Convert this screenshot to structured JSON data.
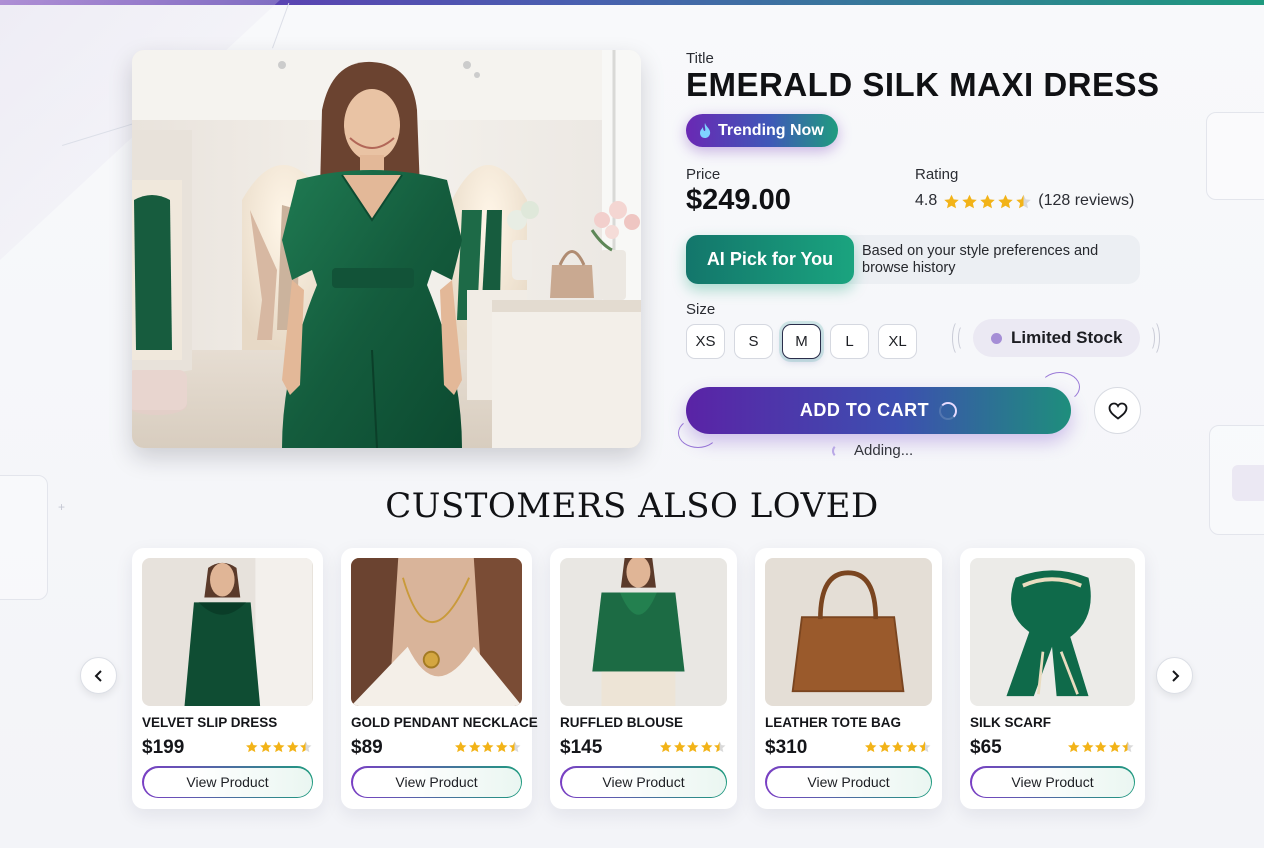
{
  "product": {
    "title_label": "Title",
    "title": "EMERALD SILK MAXI DRESS",
    "trending_badge": "Trending Now",
    "price_label": "Price",
    "price": "$249.00",
    "rating_label": "Rating",
    "rating_value": "4.8",
    "rating_stars": 4.5,
    "reviews": "(128 reviews)",
    "ai_pick_label": "AI Pick for You",
    "ai_pick_note": "Based on your style preferences and browse history",
    "size_label": "Size",
    "sizes": [
      "XS",
      "S",
      "M",
      "L",
      "XL"
    ],
    "selected_size": "M",
    "stock_badge": "Limited Stock",
    "add_to_cart_label": "ADD TO CART",
    "adding_status": "Adding...",
    "wishlist_icon": "heart-icon"
  },
  "recommendations": {
    "title": "CUSTOMERS ALSO LOVED",
    "items": [
      {
        "name": "VELVET SLIP DRESS",
        "price": "$199",
        "stars": 4.5,
        "button": "View Product"
      },
      {
        "name": "GOLD PENDANT NECKLACE",
        "price": "$89",
        "stars": 4.5,
        "button": "View Product"
      },
      {
        "name": "RUFFLED BLOUSE",
        "price": "$145",
        "stars": 4.5,
        "button": "View Product"
      },
      {
        "name": "LEATHER TOTE BAG",
        "price": "$310",
        "stars": 4.5,
        "button": "View Product"
      },
      {
        "name": "SILK SCARF",
        "price": "$65",
        "stars": 4.5,
        "button": "View Product"
      }
    ],
    "prev_icon": "chevron-left-icon",
    "next_icon": "chevron-right-icon"
  },
  "colors": {
    "accent_purple": "#6a28b4",
    "accent_teal": "#1aa47f",
    "star_gold": "#f2b318"
  }
}
